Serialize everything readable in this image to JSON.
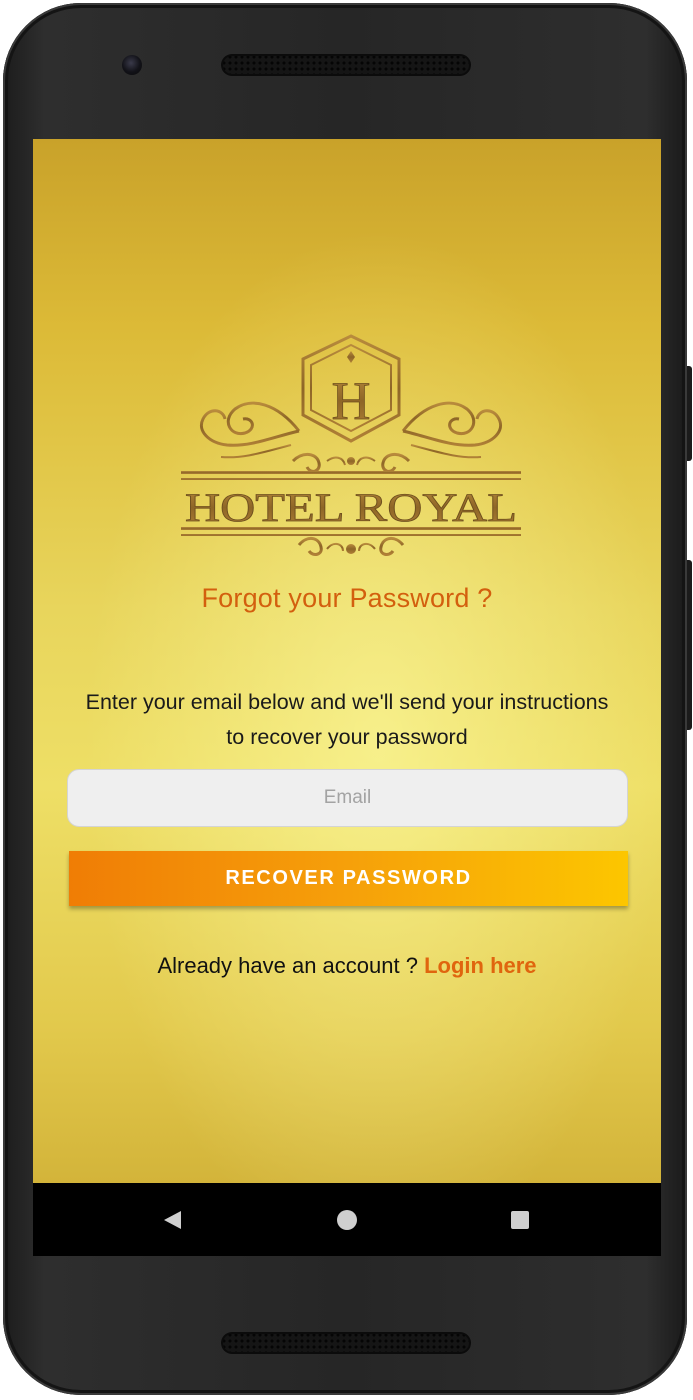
{
  "logo": {
    "initial": "H",
    "brand": "HOTEL ROYAL"
  },
  "title": "Forgot your Password ?",
  "instructions": {
    "line1": "Enter your email below and we'll send your instructions",
    "line2": "to recover your password"
  },
  "email": {
    "placeholder": "Email",
    "value": ""
  },
  "recover_button": "RECOVER PASSWORD",
  "account_prompt": "Already have an account ?",
  "login_link": "Login here",
  "navbar": {
    "back_icon": "back-triangle-icon",
    "home_icon": "home-circle-icon",
    "recents_icon": "recents-square-icon"
  },
  "colors": {
    "title": "#d35f0e",
    "link": "#e0650e",
    "button_start": "#f07d05",
    "button_end": "#fcc600",
    "background_gold": "#e8d55c"
  }
}
